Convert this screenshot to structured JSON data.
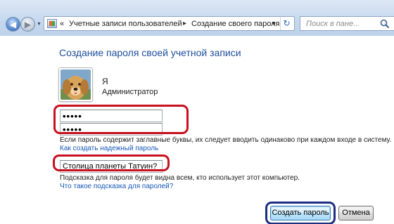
{
  "address_bar": {
    "recent_pages_glyph": "▼",
    "breadcrumbs": [
      "«",
      "Учетные записи пользователей",
      "Создание своего пароля"
    ],
    "separator": "▸",
    "dropdown_glyph": "▼",
    "refresh_glyph": "↻",
    "search_placeholder": "Поиск в пане..."
  },
  "page": {
    "title": "Создание пароля своей учетной записи",
    "user": {
      "name": "Я",
      "role": "Администратор",
      "avatar": "dog-avatar"
    },
    "password_value": "•••••",
    "confirm_password_value": "•••••",
    "case_note": "Если пароль содержит заглавные буквы, их следует вводить одинаково при каждом входе в систему.",
    "strong_password_link": "Как создать надежный пароль",
    "hint_value": "Столица планеты Татуин?",
    "hint_note": "Подсказка для пароля будет видна всем, кто использует этот компьютер.",
    "hint_link": "Что такое подсказка для паролей?"
  },
  "buttons": {
    "create": "Создать пароль",
    "cancel": "Отмена"
  },
  "colors": {
    "title_blue": "#1e4f9c",
    "link_blue": "#1558b8",
    "highlight_red": "#c8101e",
    "highlight_navy": "#1c2f80"
  }
}
